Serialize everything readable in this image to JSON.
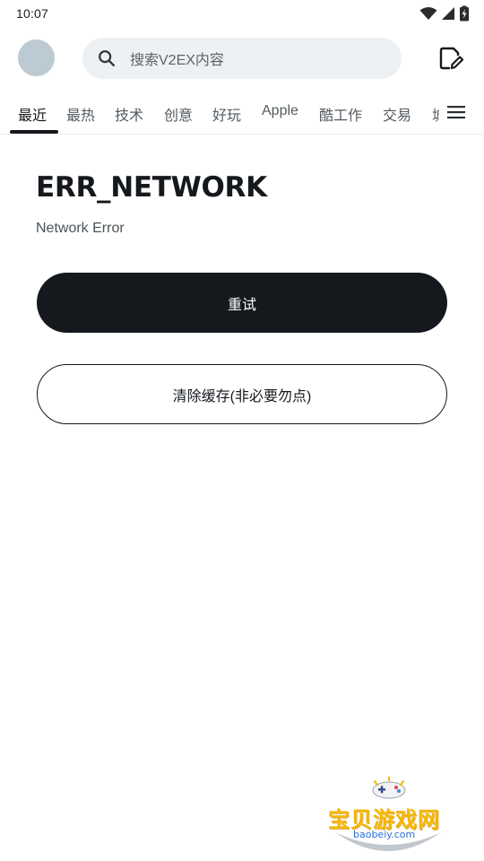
{
  "status_bar": {
    "time": "10:07",
    "icons": [
      "wifi-icon",
      "cell-signal-icon",
      "battery-charging-icon"
    ]
  },
  "header": {
    "avatar": "avatar",
    "search": {
      "placeholder": "搜索V2EX内容",
      "icon": "search-icon"
    },
    "compose_icon": "edit-note-icon"
  },
  "tabs": {
    "items": [
      {
        "label": "最近",
        "active": true
      },
      {
        "label": "最热"
      },
      {
        "label": "技术"
      },
      {
        "label": "创意"
      },
      {
        "label": "好玩"
      },
      {
        "label": "Apple"
      },
      {
        "label": "酷工作"
      },
      {
        "label": "交易"
      },
      {
        "label": "城"
      }
    ],
    "menu_icon": "menu-icon"
  },
  "error": {
    "title": "ERR_NETWORK",
    "message": "Network Error"
  },
  "actions": {
    "retry_label": "重试",
    "clear_cache_label": "清除缓存(非必要勿点)"
  },
  "watermark": {
    "text": "宝贝游戏网",
    "url": "baobeiy.com"
  },
  "colors": {
    "primary": "#15191d",
    "search_bg": "#eef1f3",
    "avatar_bg": "#bccad4",
    "watermark_yellow": "#f6b400",
    "watermark_blue": "#2a6fd6"
  }
}
